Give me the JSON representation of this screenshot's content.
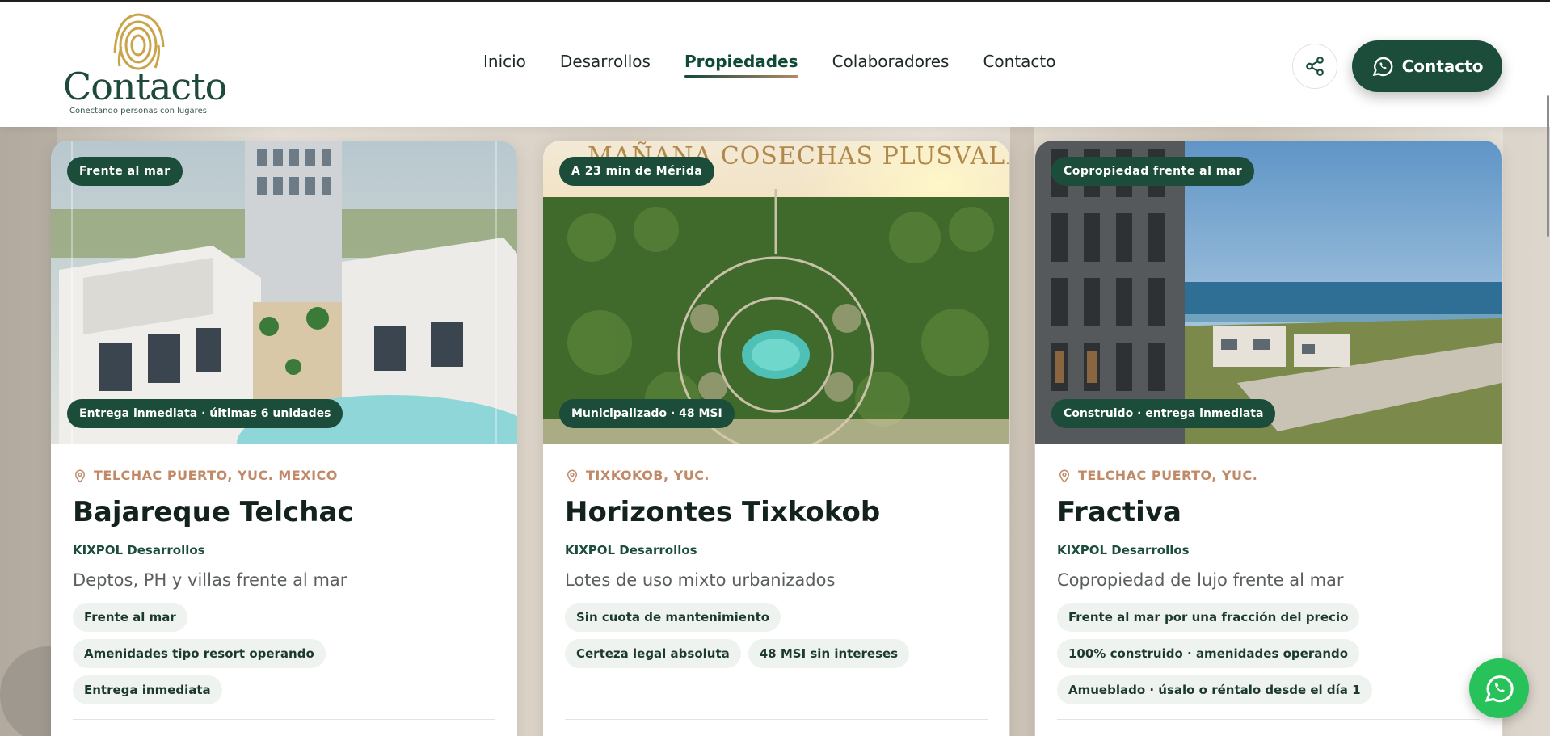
{
  "header": {
    "logo": {
      "word": "Contacto",
      "tagline": "Conectando personas con lugares"
    },
    "nav": [
      {
        "label": "Inicio",
        "active": false
      },
      {
        "label": "Desarrollos",
        "active": false
      },
      {
        "label": "Propiedades",
        "active": true
      },
      {
        "label": "Colaboradores",
        "active": false
      },
      {
        "label": "Contacto",
        "active": false
      }
    ],
    "share_icon": "share-icon",
    "contact_button": {
      "label": "Contacto",
      "icon": "whatsapp-icon"
    }
  },
  "cards": [
    {
      "badge_top": "Frente al mar",
      "badge_bottom": "Entrega inmediata · últimas 6 unidades",
      "location": "TELCHAC PUERTO, YUC. MEXICO",
      "title": "Bajareque Telchac",
      "developer": "KIXPOL Desarrollos",
      "description": "Deptos, PH y villas frente al mar",
      "tags": [
        "Frente al mar",
        "Amenidades tipo resort operando",
        "Entrega inmediata"
      ]
    },
    {
      "badge_top": "A 23 min de Mérida",
      "badge_bottom": "Municipalizado · 48 MSI",
      "image_caption": "MAÑANA COSECHAS PLUSVALÍA.",
      "location": "TIXKOKOB, YUC.",
      "title": "Horizontes Tixkokob",
      "developer": "KIXPOL Desarrollos",
      "description": "Lotes de uso mixto urbanizados",
      "tags": [
        "Sin cuota de mantenimiento",
        "Certeza legal absoluta",
        "48 MSI sin intereses"
      ]
    },
    {
      "badge_top": "Copropiedad frente al mar",
      "badge_bottom": "Construido · entrega inmediata",
      "location": "TELCHAC PUERTO, YUC.",
      "title": "Fractiva",
      "developer": "KIXPOL Desarrollos",
      "description": "Copropiedad de lujo frente al mar",
      "tags": [
        "Frente al mar por una fracción del precio",
        "100% construido · amenidades operando",
        "Amueblado · úsalo o réntalo desde el día 1"
      ]
    }
  ],
  "floating_whatsapp": {
    "icon": "whatsapp-icon"
  },
  "colors": {
    "brand_green": "#1b4d3a",
    "accent_copper": "#c08a68",
    "tag_bg": "#eef3ef",
    "whatsapp": "#27c35a"
  }
}
